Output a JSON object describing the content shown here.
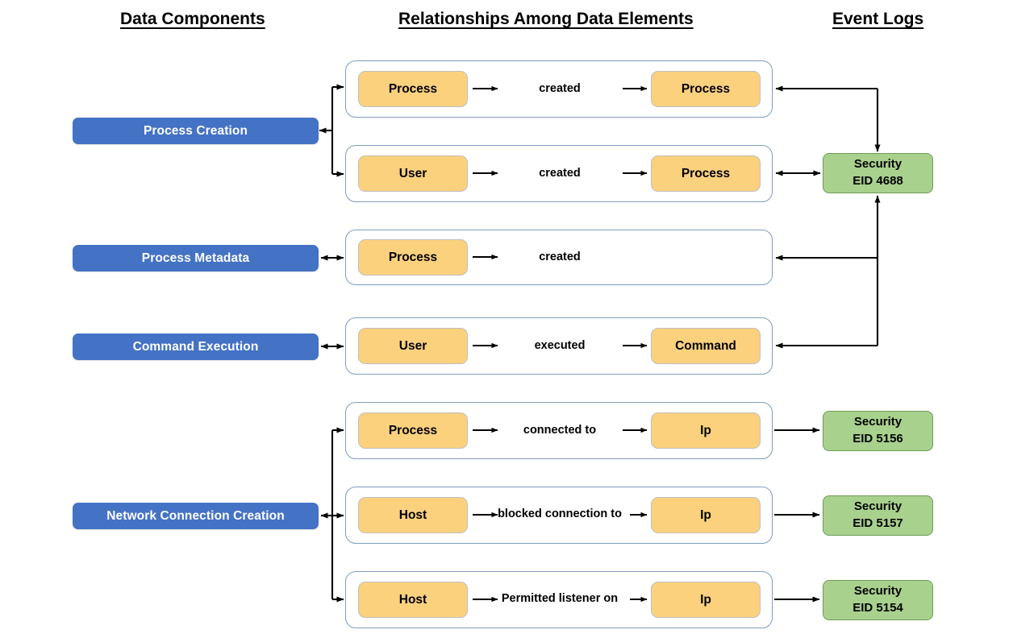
{
  "headings": {
    "data_components": "Data Components",
    "relationships": "Relationships Among Data Elements",
    "event_logs": "Event Logs"
  },
  "data_components": [
    {
      "label": "Process Creation"
    },
    {
      "label": "Process Metadata"
    },
    {
      "label": "Command Execution"
    },
    {
      "label": "Network Connection Creation"
    }
  ],
  "relationships": [
    {
      "source": "Process",
      "verb": "created",
      "target": "Process"
    },
    {
      "source": "User",
      "verb": "created",
      "target": "Process"
    },
    {
      "source": "Process",
      "verb": "created",
      "target": ""
    },
    {
      "source": "User",
      "verb": "executed",
      "target": "Command"
    },
    {
      "source": "Process",
      "verb": "connected to",
      "target": "Ip"
    },
    {
      "source": "Host",
      "verb": "blocked connection to",
      "target": "Ip"
    },
    {
      "source": "Host",
      "verb": "Permitted listener on",
      "target": "Ip"
    }
  ],
  "event_logs": [
    {
      "channel": "Security",
      "eid": "EID 4688"
    },
    {
      "channel": "Security",
      "eid": "EID 5156"
    },
    {
      "channel": "Security",
      "eid": "EID 5157"
    },
    {
      "channel": "Security",
      "eid": "EID 5154"
    }
  ],
  "colors": {
    "component_blue": "#4472C4",
    "entity_orange": "#FBD17E",
    "eventlog_green": "#A9D18E",
    "container_border": "#7F9DC0",
    "connector": "#000000"
  }
}
